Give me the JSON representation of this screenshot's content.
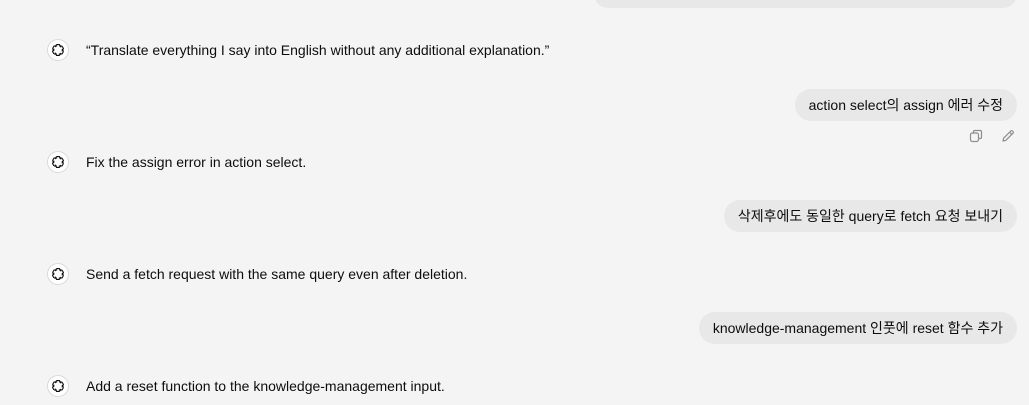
{
  "conversation": {
    "messages": [
      {
        "role": "assistant",
        "text": "“Translate everything I say into English without any additional explanation.”"
      },
      {
        "role": "user",
        "text": "action select의 assign 에러 수정"
      },
      {
        "role": "assistant",
        "text": "Fix the assign error in action select."
      },
      {
        "role": "user",
        "text": "삭제후에도 동일한 query로 fetch 요청 보내기"
      },
      {
        "role": "assistant",
        "text": "Send a fetch request with the same query even after deletion."
      },
      {
        "role": "user",
        "text": "knowledge-management 인풋에 reset 함수 추가"
      },
      {
        "role": "assistant",
        "text": "Add a reset function to the knowledge-management input."
      }
    ],
    "message_actions": [
      {
        "name": "copy",
        "icon": "copy-icon"
      },
      {
        "name": "edit",
        "icon": "pencil-icon"
      }
    ]
  },
  "theme": {
    "background": "#f4f4f4",
    "user_bubble": "#e8e8e8",
    "text": "#0d0d0d",
    "icon": "#8e8e8e"
  }
}
